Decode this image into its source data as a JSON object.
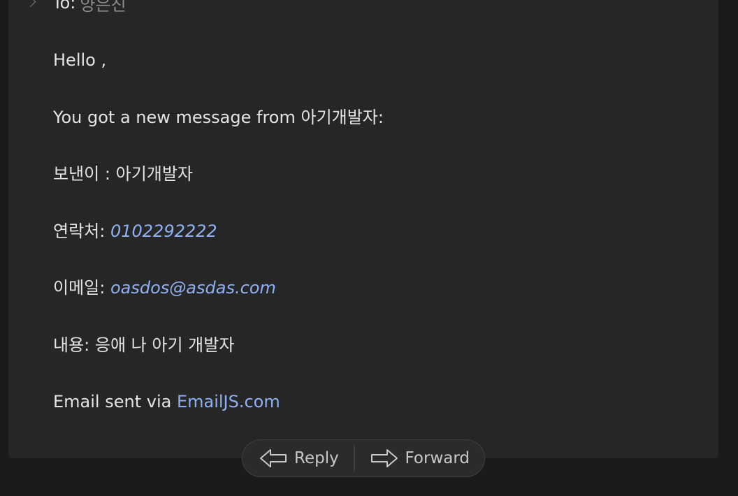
{
  "header": {
    "to_label": "To:",
    "to_name": "양은진"
  },
  "message": {
    "greeting": "Hello ,",
    "intro": "You got a new message from 아기개발자:",
    "sender_label": "보낸이 :",
    "sender_value": "아기개발자",
    "phone_label": "연락처:",
    "phone_value": "0102292222",
    "email_label": "이메일:",
    "email_value": "oasdos@asdas.com",
    "content_label": "내용:",
    "content_value": "응애 나 아기 개발자",
    "footer_prefix": "Email sent via",
    "footer_link": "EmailJS.com"
  },
  "actions": {
    "reply_label": "Reply",
    "forward_label": "Forward"
  },
  "colors": {
    "background": "#1b1b1d",
    "card": "#262627",
    "text": "#e4e4e6",
    "link": "#8fb1f3",
    "muted": "#8c8c90"
  },
  "icons": {
    "expand": "chevron-right-icon",
    "reply": "reply-arrow-icon",
    "forward": "forward-arrow-icon"
  }
}
